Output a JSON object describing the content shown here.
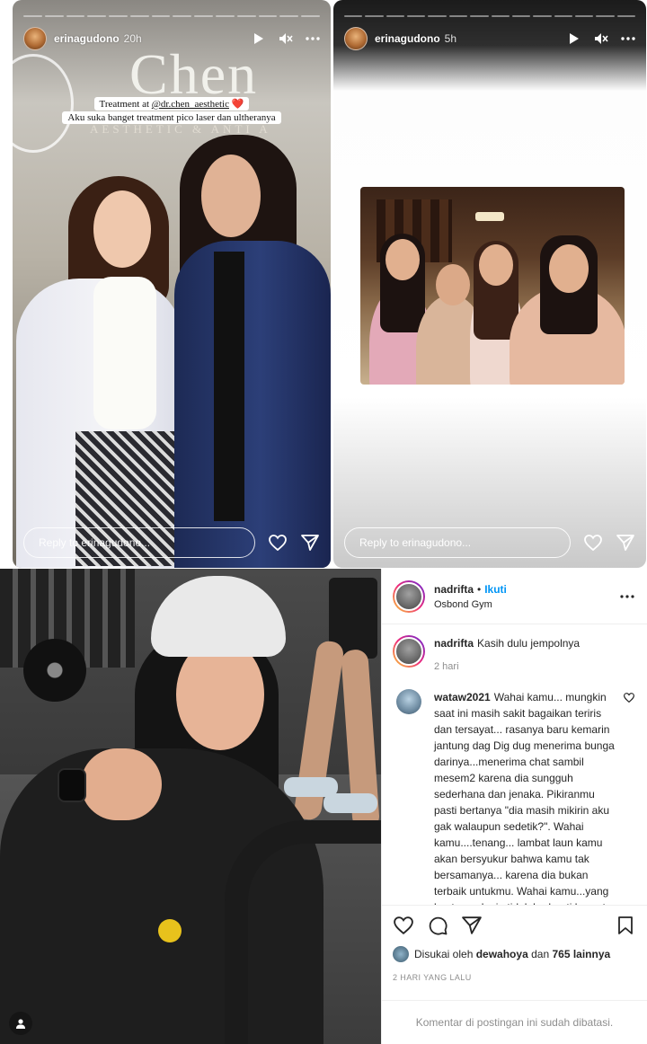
{
  "stories": [
    {
      "username": "erinagudono",
      "time": "20h",
      "brand_sign": "Chen",
      "brand_sub": "AESTHETIC & ANTI A",
      "caption_prefix": "Treatment at ",
      "caption_mention": "@dr.chen_aesthetic",
      "caption_emoji": "❤️",
      "caption_line2": "Aku suka banget treatment pico laser dan ultheranya",
      "reply_placeholder": "Reply to erinagudono...",
      "progress_total": 14,
      "progress_done": 0
    },
    {
      "username": "erinagudono",
      "time": "5h",
      "reply_placeholder": "Reply to erinagudono...",
      "progress_total": 14,
      "progress_done": 0
    }
  ],
  "post": {
    "username": "nadrifta",
    "dot": "•",
    "follow_label": "Ikuti",
    "location": "Osbond Gym",
    "caption_user": "nadrifta",
    "caption_text": "Kasih dulu jempolnya",
    "caption_age": "2 hari",
    "comment_user": "wataw2021",
    "comment_text": "Wahai kamu... mungkin saat ini masih sakit bagaikan teriris dan tersayat... rasanya baru kemarin jantung dag Dig dug menerima bunga darinya...menerima chat sambil mesem2 karena dia sungguh sederhana dan jenaka. Pikiranmu pasti bertanya \"dia masih mikirin aku gak walaupun sedetik?\". Wahai kamu....tenang... lambat laun kamu akan bersyukur bahwa kamu tak bersamanya... karena dia bukan terbaik untukmu. Wahai kamu...yang kuat ya...dunia tidak berhenti berputar saat dia tidak",
    "likes_prefix": "Disukai oleh",
    "likes_user": "dewahoya",
    "likes_and": "dan",
    "likes_count": "765 lainnya",
    "date": "2 HARI YANG LALU",
    "comments_closed": "Komentar di postingan ini sudah dibatasi."
  },
  "icons": {
    "play": "play-icon",
    "mute": "mute-icon",
    "more": "more-icon",
    "heart": "heart-icon",
    "send": "send-icon",
    "comment": "comment-icon",
    "save": "bookmark-icon",
    "user": "user-icon"
  },
  "colors": {
    "accent": "#0095f6",
    "muted": "#8e8e8e",
    "text": "#262626"
  }
}
